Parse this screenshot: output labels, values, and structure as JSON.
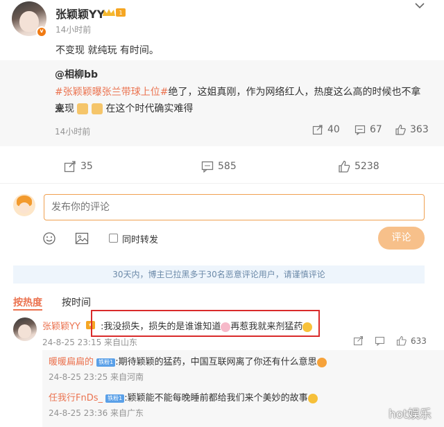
{
  "post": {
    "author": "张颖颖YY",
    "time": "14小时前",
    "text": "不变现 就纯玩 有时间。",
    "menu_icon": "chevron-down-icon"
  },
  "repost": {
    "author": "@相柳bb",
    "topic": "#张颖颖曝张兰带球上位#",
    "text_a": "绝了，这姐真刚，作为网络红人，热度这么高的时候也不拿来",
    "text_b": "变现",
    "text_c": "在这个时代确实难得",
    "time": "14小时前",
    "reposts": "40",
    "comments": "67",
    "likes": "363"
  },
  "actions": {
    "reposts": "35",
    "comments": "585",
    "likes": "5238"
  },
  "composer": {
    "placeholder": "发布你的评论",
    "repost_label": "同时转发",
    "submit_label": "评论"
  },
  "notice": "30天内，博主已拉黑多于30名恶意评论用户，请谨慎评论",
  "sort_tabs": {
    "hot": "按热度",
    "time": "按时间"
  },
  "comments": [
    {
      "name": "张颖颖YY",
      "text_a": ":我没损失，损失的是谁谁知道",
      "text_b": "再惹我就来剂猛药",
      "time": "24-8-25 23:15 来自山东",
      "likes": "633"
    },
    {
      "name": "暖暖扁扁的",
      "badge": "铁粉1",
      "text": ":期待颖颖的猛药，中国互联网离了你还有什么意思",
      "time": "24-8-25 23:25 来自河南"
    },
    {
      "name": "任我行FnDs_",
      "badge": "铁粉1",
      "text": ":颖颖能不能每晚睡前都给我们来个美妙的故事",
      "time": "24-8-25 23:36 来自广东"
    }
  ],
  "watermark": "hot娱乐",
  "colors": {
    "accent": "#eb7350",
    "input_border": "#f0a050",
    "button_disabled": "#f7c08a",
    "notice_bg": "#eef5fc",
    "highlight_box": "#d92a2a"
  }
}
